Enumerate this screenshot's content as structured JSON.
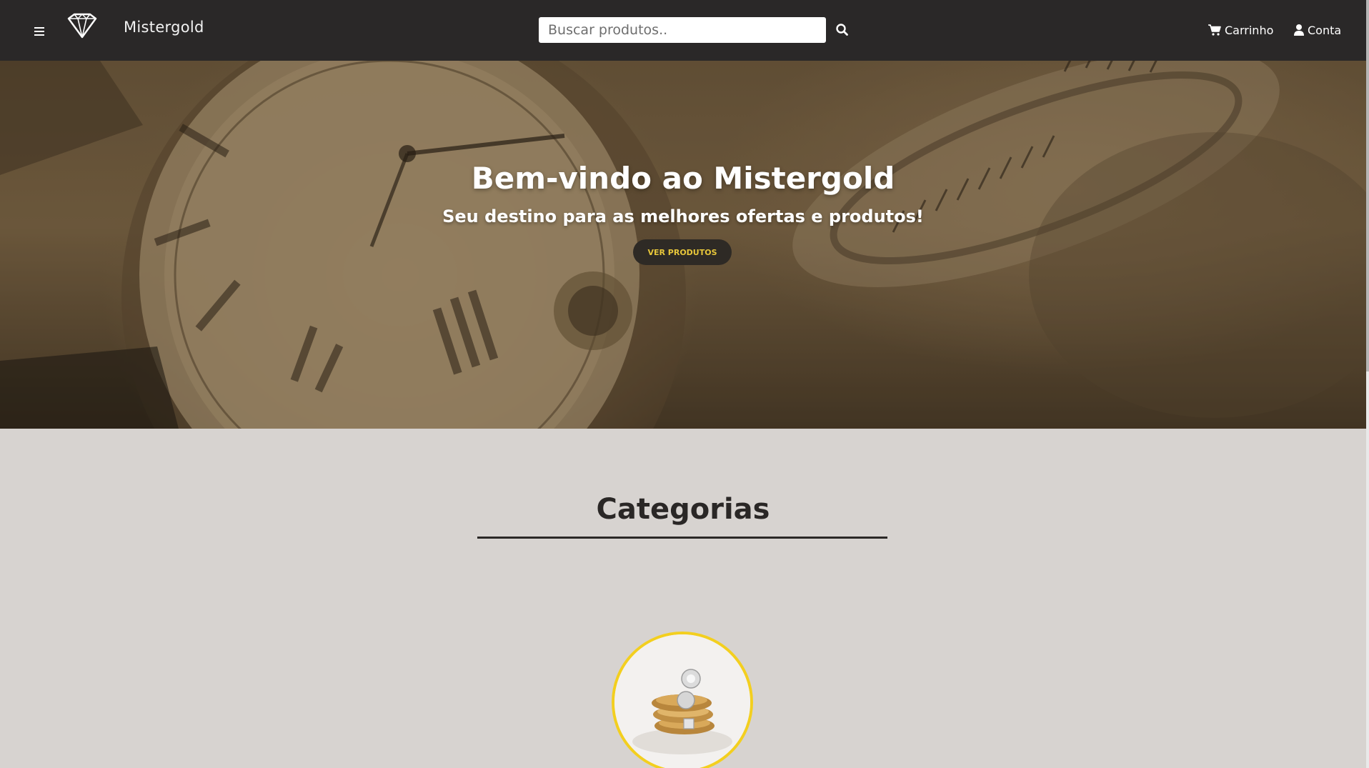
{
  "header": {
    "brand": "Mistergold",
    "search_placeholder": "Buscar produtos..",
    "cart_label": "Carrinho",
    "account_label": "Conta",
    "icons": [
      "menu-icon",
      "diamond-logo-icon",
      "search-icon",
      "cart-icon",
      "user-icon"
    ]
  },
  "hero": {
    "title": "Bem-vindo ao Mistergold",
    "subtitle": "Seu destino para as melhores ofertas e produtos!",
    "cta_label": "VER PRODUTOS"
  },
  "categories": {
    "title": "Categorias"
  },
  "colors": {
    "header_bg": "#2a2828",
    "page_bg": "#d7d3d0",
    "accent_gold": "#f3cf1f",
    "cta_text": "#e7c63a",
    "cta_bg": "#2e2a25"
  }
}
